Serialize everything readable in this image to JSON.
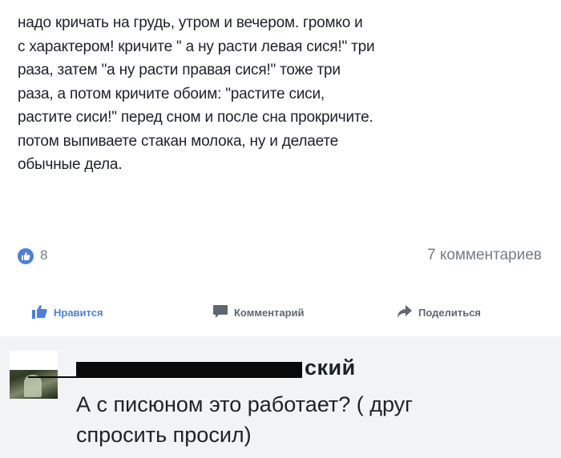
{
  "post": {
    "text_lines": [
      "надо кричать на грудь, утром и вечером. громко и",
      "с характером! кричите \" а ну расти левая сися!\" три",
      "раза, затем \"а ну расти правая сися!\" тоже три",
      "раза, а потом кричите обоим: \"растите сиси,",
      "растите сиси!\" перед сном и после сна прокричите.",
      "потом выпиваете стакан молока, ну и делаете",
      "обычные дела."
    ],
    "likes_count": "8",
    "comments_count": "7 комментариев"
  },
  "actions": {
    "like_label": "Нравится",
    "comment_label": "Комментарий",
    "share_label": "Поделиться"
  },
  "comment": {
    "author_visible_suffix": "ский",
    "text_lines": [
      "А с писюном это работает? ( друг",
      "спросить просил)"
    ]
  },
  "colors": {
    "like_blue": "#4f7fd9",
    "action_gray": "#606770",
    "comment_bg": "#f2f3f5"
  },
  "icons": [
    "like-reaction-icon",
    "thumbs-up-icon",
    "comment-icon",
    "share-arrow-icon"
  ]
}
